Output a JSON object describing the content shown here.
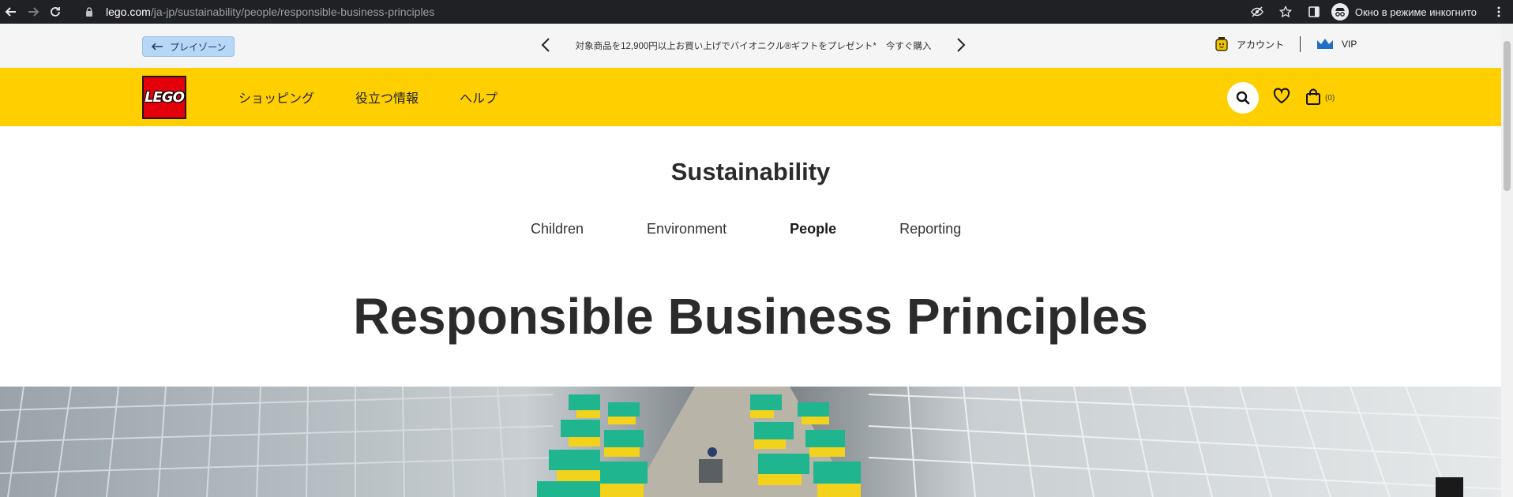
{
  "browser": {
    "url_host": "lego.com",
    "url_path": "/ja-jp/sustainability/people/responsible-business-principles",
    "incognito_label": "Окно в режиме инкогнито"
  },
  "utility": {
    "playzone_label": "プレイゾーン",
    "promo_text": "対象商品を12,900円以上お買い上げでバイオニクル®ギフトをプレゼント*",
    "promo_link": "今すぐ購入",
    "account_label": "アカウント",
    "vip_label": "VIP"
  },
  "nav": {
    "logo_text": "LEGO",
    "links": [
      "ショッピング",
      "役立つ情報",
      "ヘルプ"
    ],
    "cart_count": "(0)"
  },
  "content": {
    "section_title": "Sustainability",
    "subnav": [
      "Children",
      "Environment",
      "People",
      "Reporting"
    ],
    "active_subnav": "People",
    "page_heading": "Responsible Business Principles"
  },
  "colors": {
    "brand_yellow": "#ffcf00",
    "brand_red": "#e3000b",
    "playzone_blue": "#b7d7f7",
    "machine_green": "#1fb58f",
    "machine_yellow": "#f2d21b"
  },
  "icons": [
    "back-arrow-icon",
    "forward-arrow-icon",
    "reload-icon",
    "lock-icon",
    "eye-off-icon",
    "star-icon",
    "sidepanel-icon",
    "incognito-icon",
    "menu-dots-icon",
    "search-icon",
    "heart-icon",
    "bag-icon",
    "chevron-left-icon",
    "chevron-right-icon",
    "account-icon",
    "vip-icon"
  ]
}
